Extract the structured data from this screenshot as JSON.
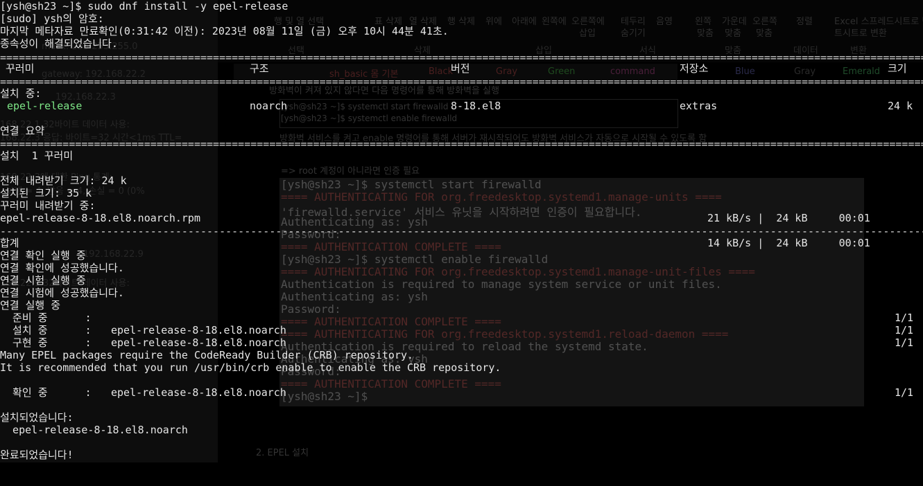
{
  "ghost": {
    "ribbon": {
      "items": [
        "행 및 열 선택",
        "표 삭제",
        "열 삭제",
        "행 삭제",
        "위에",
        "아래에",
        "왼쪽에",
        "오른쪽에",
        "테두리",
        "음영",
        "왼쪽",
        "가운데",
        "오른쪽",
        "정렬",
        "Excel 스프레드시트로 변환"
      ],
      "items_row2": [
        "삽입",
        "숨기기",
        "맞춤",
        "맞춤",
        "맞춤",
        "트시트로 변환"
      ],
      "groups": [
        "선택",
        "삭제",
        "삽입",
        "서식",
        "맞춤",
        "데이터",
        "변환"
      ]
    },
    "doc": {
      "bullet_text": "방화벽이 켜져 있지 않다면 다음 명령어를 통해 방화벽을 실행",
      "code_line1": "[ysh@sh23 ~]$ systemctl start firewalld",
      "code_line2": "[ysh@sh23 ~]$ systemctl enable firewalld",
      "note": "방화벽 서비스를 켜고 enable 명령어를 통해 서버가 재시작되어도 방화벽 서비스가 자동으로 시작될 수 있도록 함",
      "root_note": "=> root 계정이 아니라면 인증 필요",
      "section": "2. EPEL 설치"
    },
    "inner_terminal": [
      {
        "text": "[ysh@sh23 ~]$ systemctl start firewalld",
        "color": "#d0d0d0"
      },
      {
        "text": "==== AUTHENTICATING FOR org.freedesktop.systemd1.manage-units ====",
        "color": "#d4504c"
      },
      {
        "text": "'firewalld.service' 서비스 유닛을 시작하려면 인증이 필요합니다.",
        "color": "#d0d0d0"
      },
      {
        "text": "Authenticating as: ysh",
        "color": "#d0d0d0"
      },
      {
        "text": "Password:",
        "color": "#d0d0d0"
      },
      {
        "text": "==== AUTHENTICATION COMPLETE ====",
        "color": "#d4504c"
      },
      {
        "text": "[ysh@sh23 ~]$ systemctl enable firewalld",
        "color": "#d0d0d0"
      },
      {
        "text": "==== AUTHENTICATING FOR org.freedesktop.systemd1.manage-unit-files ====",
        "color": "#d4504c"
      },
      {
        "text": "Authentication is required to manage system service or unit files.",
        "color": "#d0d0d0"
      },
      {
        "text": "Authenticating as: ysh",
        "color": "#d0d0d0"
      },
      {
        "text": "Password:",
        "color": "#d0d0d0"
      },
      {
        "text": "==== AUTHENTICATION COMPLETE ====",
        "color": "#d4504c"
      },
      {
        "text": "==== AUTHENTICATING FOR org.freedesktop.systemd1.reload-daemon ====",
        "color": "#d4504c"
      },
      {
        "text": "Authentication is required to reload the systemd state.",
        "color": "#d0d0d0"
      },
      {
        "text": "Authenticating as: ysh",
        "color": "#d0d0d0"
      },
      {
        "text": "Password:",
        "color": "#d0d0d0"
      },
      {
        "text": "==== AUTHENTICATION COMPLETE ====",
        "color": "#d4504c"
      },
      {
        "text": "[ysh@sh23 ~]$",
        "color": "#d0d0d0"
      }
    ],
    "left_panel": [
      "mask: 255.255.255.0",
      "gateway: 192.168.22.2",
      "192.168.22.3",
      "168.22.1 32바이트 데이터 사용:",
      "168.22.3 응답: 바이트=32 시간<1ms TTL=",
      "168.22.3에 대한 Ping 통계:",
      "  보냄 = 4, 받음 = 4, 손실 = 0 (0%",
      "192.168.22.9",
      "168.22.9 32바이트 데이터 사용:"
    ],
    "palette_labels": [
      "sh_basic 몸 기본",
      "Black",
      "Gray",
      "Green",
      "command",
      "Blue",
      "Gray",
      "Emerald"
    ]
  },
  "terminal": {
    "prompt_line": "[ysh@sh23 ~]$ sudo dnf install -y epel-release",
    "sudo_prompt": "[sudo] ysh의 암호:",
    "meta_check": "마지막 메타자료 만료확인(0:31:42 이전): 2023년 08월 11일 (금) 오후 10시 44분 41초.",
    "deps_resolved": "종속성이 해결되었습니다.",
    "separator_double": "================================================================================================================================================================================",
    "separator_single": "--------------------------------------------------------------------------------------------------------------------------------------------------------------------------------",
    "table_header": {
      "package": "꾸러미",
      "arch": "구조",
      "version": "버전",
      "repo": "저장소",
      "size": "크기"
    },
    "installing_label": "설치 중:",
    "package_row": {
      "name": "epel-release",
      "arch": "noarch",
      "version": "8-18.el8",
      "repo": "extras",
      "size": "24 k"
    },
    "summary_label": "연결 요약",
    "install_count": "설치  1 꾸러미",
    "total_download": "전체 내려받기 크기: 24 k",
    "installed_size": "설치된 크기: 35 k",
    "downloading": "꾸러미 내려받기 중:",
    "download_file": "epel-release-8-18.el8.noarch.rpm",
    "download_rate": "21 kB/s |  24 kB     00:01",
    "total_label": "합계",
    "total_rate": "14 kB/s |  24 kB     00:01",
    "transaction_lines": [
      "연결 확인 실행 중",
      "연결 확인에 성공했습니다.",
      "연결 시험 실행 중",
      "연결 시험에 성공했습니다.",
      "연결 실행 중"
    ],
    "steps": [
      {
        "label": "  준비 중      :",
        "detail": "",
        "count": "1/1"
      },
      {
        "label": "  설치 중      :",
        "detail": "epel-release-8-18.el8.noarch",
        "count": "1/1"
      },
      {
        "label": "  구현 중      :",
        "detail": "epel-release-8-18.el8.noarch",
        "count": "1/1"
      }
    ],
    "crb_line1": "Many EPEL packages require the CodeReady Builder (CRB) repository.",
    "crb_line2": "It is recommended that you run /usr/bin/crb enable to enable the CRB repository.",
    "verify": {
      "label": "  확인 중      :",
      "detail": "epel-release-8-18.el8.noarch",
      "count": "1/1"
    },
    "installed_label": "설치되었습니다:",
    "installed_pkg": "  epel-release-8-18.el8.noarch",
    "complete": "완료되었습니다!"
  }
}
